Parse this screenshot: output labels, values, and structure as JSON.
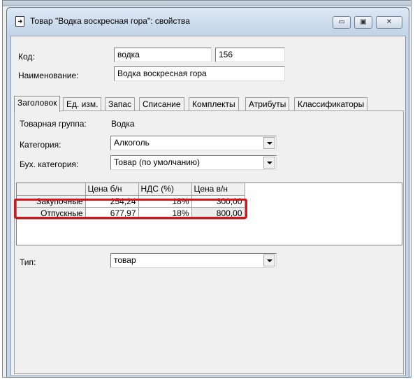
{
  "window": {
    "title": "Товар \"Водка воскресная гора\": свойства",
    "minimize_glyph": "▭",
    "maximize_glyph": "▣",
    "close_glyph": "✕"
  },
  "form": {
    "code_label": "Код:",
    "code_value": "водка",
    "code_number": "156",
    "name_label": "Наименование:",
    "name_value": "Водка воскресная гора"
  },
  "tabs": [
    {
      "label": "Заголовок",
      "active": true
    },
    {
      "label": "Ед. изм.",
      "active": false
    },
    {
      "label": "Запас",
      "active": false
    },
    {
      "label": "Списание",
      "active": false
    },
    {
      "label": "Комплекты",
      "active": false
    },
    {
      "label": "Атрибуты",
      "active": false
    },
    {
      "label": "Классификаторы",
      "active": false
    }
  ],
  "header_tab": {
    "group_label": "Товарная группа:",
    "group_value": "Водка",
    "category_label": "Категория:",
    "category_value": "Алкоголь",
    "acc_category_label": "Бух. категория:",
    "acc_category_value": "Товар (по умолчанию)",
    "type_label": "Тип:",
    "type_value": "товар"
  },
  "price_grid": {
    "columns": [
      "",
      "Цена б/н",
      "НДС (%)",
      "Цена в/н"
    ],
    "rows": [
      {
        "name": "Закупочные",
        "net": "254,24",
        "vat": "18%",
        "gross": "300,00"
      },
      {
        "name": "Отпускные",
        "net": "677,97",
        "vat": "18%",
        "gross": "800,00"
      }
    ]
  },
  "colors": {
    "highlight": "#d5141b",
    "window_frame": "#c6d6e8",
    "dialog_bg": "#f0f0f0"
  }
}
